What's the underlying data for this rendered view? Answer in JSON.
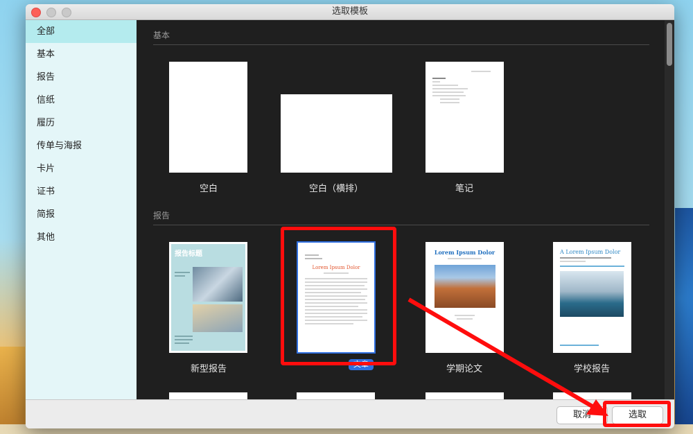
{
  "window": {
    "title": "选取模板"
  },
  "sidebar": {
    "items": [
      {
        "label": "全部",
        "selected": true
      },
      {
        "label": "基本"
      },
      {
        "label": "报告"
      },
      {
        "label": "信纸"
      },
      {
        "label": "履历"
      },
      {
        "label": "传单与海报"
      },
      {
        "label": "卡片"
      },
      {
        "label": "证书"
      },
      {
        "label": "简报"
      },
      {
        "label": "其他"
      }
    ]
  },
  "sections": [
    {
      "title": "基本",
      "templates": [
        {
          "label": "空白"
        },
        {
          "label": "空白（横排）"
        },
        {
          "label": "笔记"
        }
      ]
    },
    {
      "title": "报告",
      "templates": [
        {
          "label": "新型报告",
          "thumb_title": "报告标题"
        },
        {
          "label": "文章",
          "thumb_title": "Lorem Ipsum Dolor",
          "selected": true
        },
        {
          "label": "学期论文",
          "thumb_title": "Lorem Ipsum Dolor"
        },
        {
          "label": "学校报告",
          "thumb_title": "A Lorem Ipsum Dolor"
        }
      ]
    }
  ],
  "buttons": {
    "cancel": "取消",
    "select": "选取"
  },
  "colors": {
    "sidebar_bg": "#e4f6f8",
    "sidebar_selected": "#b4ebee",
    "content_bg": "#1f1f1f",
    "annotation": "#ff0d0d",
    "selection_blue": "#2f6fe0"
  }
}
